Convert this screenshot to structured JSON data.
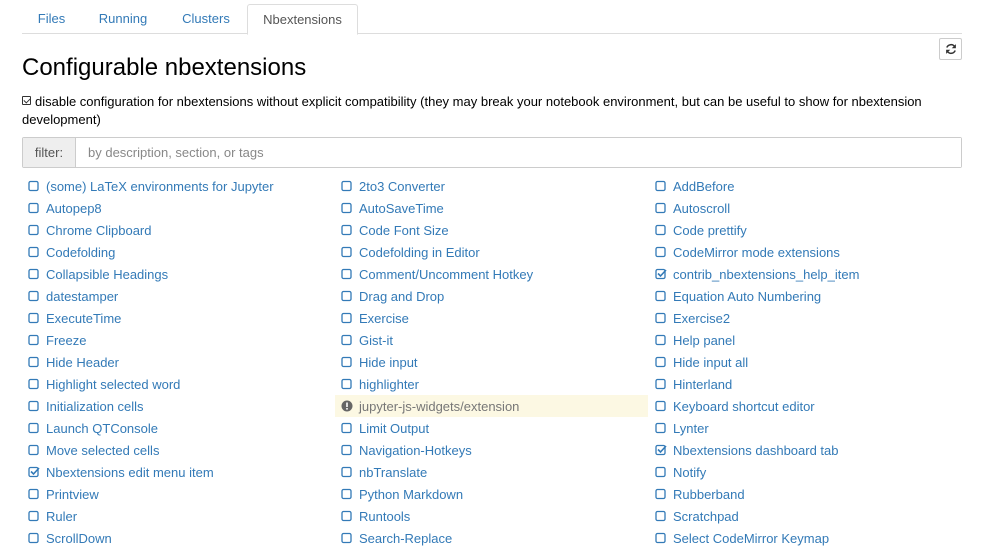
{
  "tabs": [
    {
      "label": "Files",
      "active": false
    },
    {
      "label": "Running",
      "active": false
    },
    {
      "label": "Clusters",
      "active": false
    },
    {
      "label": "Nbextensions",
      "active": true
    }
  ],
  "refresh_icon": "refresh-icon",
  "page": {
    "title": "Configurable nbextensions",
    "compat_checked": true,
    "compat_text": "disable configuration for nbextensions without explicit compatibility (they may break your notebook environment, but can be useful to show for nbextension development)"
  },
  "filter": {
    "label": "filter:",
    "placeholder": "by description, section, or tags",
    "value": ""
  },
  "colors": {
    "link": "#337ab7",
    "warn_bg": "#fcf8e3",
    "warn_text": "#777777"
  },
  "extensions": [
    [
      {
        "name": "(some) LaTeX environments for Jupyter",
        "state": "unchecked"
      },
      {
        "name": "Autopep8",
        "state": "unchecked"
      },
      {
        "name": "Chrome Clipboard",
        "state": "unchecked"
      },
      {
        "name": "Codefolding",
        "state": "unchecked"
      },
      {
        "name": "Collapsible Headings",
        "state": "unchecked"
      },
      {
        "name": "datestamper",
        "state": "unchecked"
      },
      {
        "name": "ExecuteTime",
        "state": "unchecked"
      },
      {
        "name": "Freeze",
        "state": "unchecked"
      },
      {
        "name": "Hide Header",
        "state": "unchecked"
      },
      {
        "name": "Highlight selected word",
        "state": "unchecked"
      },
      {
        "name": "Initialization cells",
        "state": "unchecked"
      },
      {
        "name": "Launch QTConsole",
        "state": "unchecked"
      },
      {
        "name": "Move selected cells",
        "state": "unchecked"
      },
      {
        "name": "Nbextensions edit menu item",
        "state": "checked"
      },
      {
        "name": "Printview",
        "state": "unchecked"
      },
      {
        "name": "Ruler",
        "state": "unchecked"
      },
      {
        "name": "ScrollDown",
        "state": "unchecked"
      }
    ],
    [
      {
        "name": "2to3 Converter",
        "state": "unchecked"
      },
      {
        "name": "AutoSaveTime",
        "state": "unchecked"
      },
      {
        "name": "Code Font Size",
        "state": "unchecked"
      },
      {
        "name": "Codefolding in Editor",
        "state": "unchecked"
      },
      {
        "name": "Comment/Uncomment Hotkey",
        "state": "unchecked"
      },
      {
        "name": "Drag and Drop",
        "state": "unchecked"
      },
      {
        "name": "Exercise",
        "state": "unchecked"
      },
      {
        "name": "Gist-it",
        "state": "unchecked"
      },
      {
        "name": "Hide input",
        "state": "unchecked"
      },
      {
        "name": "highlighter",
        "state": "unchecked"
      },
      {
        "name": "jupyter-js-widgets/extension",
        "state": "warning"
      },
      {
        "name": "Limit Output",
        "state": "unchecked"
      },
      {
        "name": "Navigation-Hotkeys",
        "state": "unchecked"
      },
      {
        "name": "nbTranslate",
        "state": "unchecked"
      },
      {
        "name": "Python Markdown",
        "state": "unchecked"
      },
      {
        "name": "Runtools",
        "state": "unchecked"
      },
      {
        "name": "Search-Replace",
        "state": "unchecked"
      }
    ],
    [
      {
        "name": "AddBefore",
        "state": "unchecked"
      },
      {
        "name": "Autoscroll",
        "state": "unchecked"
      },
      {
        "name": "Code prettify",
        "state": "unchecked"
      },
      {
        "name": "CodeMirror mode extensions",
        "state": "unchecked"
      },
      {
        "name": "contrib_nbextensions_help_item",
        "state": "checked"
      },
      {
        "name": "Equation Auto Numbering",
        "state": "unchecked"
      },
      {
        "name": "Exercise2",
        "state": "unchecked"
      },
      {
        "name": "Help panel",
        "state": "unchecked"
      },
      {
        "name": "Hide input all",
        "state": "unchecked"
      },
      {
        "name": "Hinterland",
        "state": "unchecked"
      },
      {
        "name": "Keyboard shortcut editor",
        "state": "unchecked"
      },
      {
        "name": "Lynter",
        "state": "unchecked"
      },
      {
        "name": "Nbextensions dashboard tab",
        "state": "checked"
      },
      {
        "name": "Notify",
        "state": "unchecked"
      },
      {
        "name": "Rubberband",
        "state": "unchecked"
      },
      {
        "name": "Scratchpad",
        "state": "unchecked"
      },
      {
        "name": "Select CodeMirror Keymap",
        "state": "unchecked"
      }
    ]
  ]
}
